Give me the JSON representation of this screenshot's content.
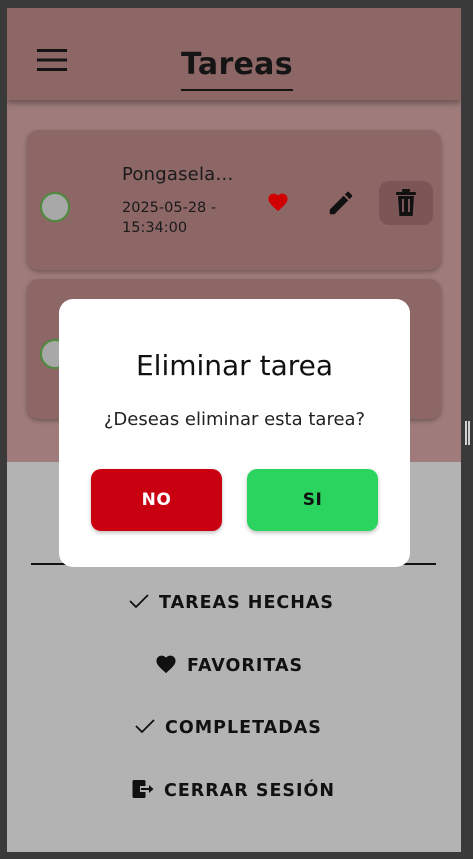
{
  "header": {
    "title": "Tareas",
    "menu_icon": "hamburger-menu-icon"
  },
  "tasks": [
    {
      "title": "Pongasela…",
      "date": "2025-05-28 - 15:34:00",
      "favorite": true,
      "completed": false
    },
    {
      "title": "",
      "date": "",
      "favorite": false,
      "completed": false
    }
  ],
  "drawer": {
    "items": [
      {
        "label": "TAREAS HECHAS",
        "icon": "check-icon"
      },
      {
        "label": "FAVORITAS",
        "icon": "heart-icon"
      },
      {
        "label": "COMPLETADAS",
        "icon": "check-icon"
      },
      {
        "label": "CERRAR SESIÓN",
        "icon": "logout-icon"
      }
    ]
  },
  "dialog": {
    "title": "Eliminar tarea",
    "message": "¿Deseas eliminar esta tarea?",
    "no_label": "NO",
    "yes_label": "SI"
  },
  "colors": {
    "header": "#8d6666",
    "card": "#8d6666",
    "drawer": "#b3b3b3",
    "no_button": "#c8000f",
    "yes_button": "#2bd35f",
    "favorite": "#d10000"
  }
}
